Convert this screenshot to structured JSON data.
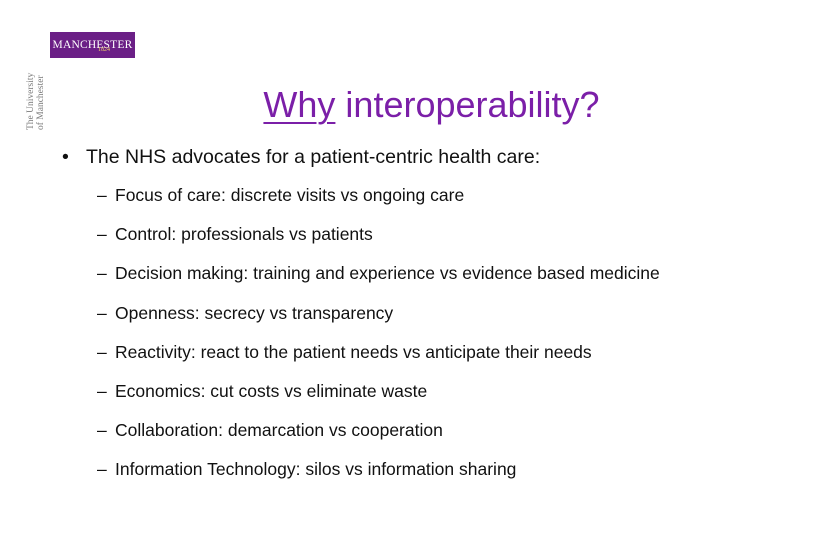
{
  "logo": {
    "wordmark": "MANCHESTER",
    "year": "1824",
    "vertical_line1": "The University",
    "vertical_line2": "of Manchester",
    "color": "#6b1f86"
  },
  "title": {
    "link_word": "Why",
    "rest": " interoperability?",
    "color": "#7b1fa8"
  },
  "main_bullet": {
    "marker": "•",
    "text": "The NHS advocates for a patient-centric health care:"
  },
  "sub_bullets": [
    "Focus of care: discrete visits vs ongoing care",
    "Control: professionals vs patients",
    "Decision making: training and experience vs evidence based medicine",
    "Openness: secrecy vs transparency",
    "Reactivity: react to the patient needs vs anticipate their needs",
    "Economics: cut costs vs eliminate waste",
    "Collaboration: demarcation vs cooperation",
    "Information Technology: silos vs information sharing"
  ],
  "sub_marker": "–"
}
